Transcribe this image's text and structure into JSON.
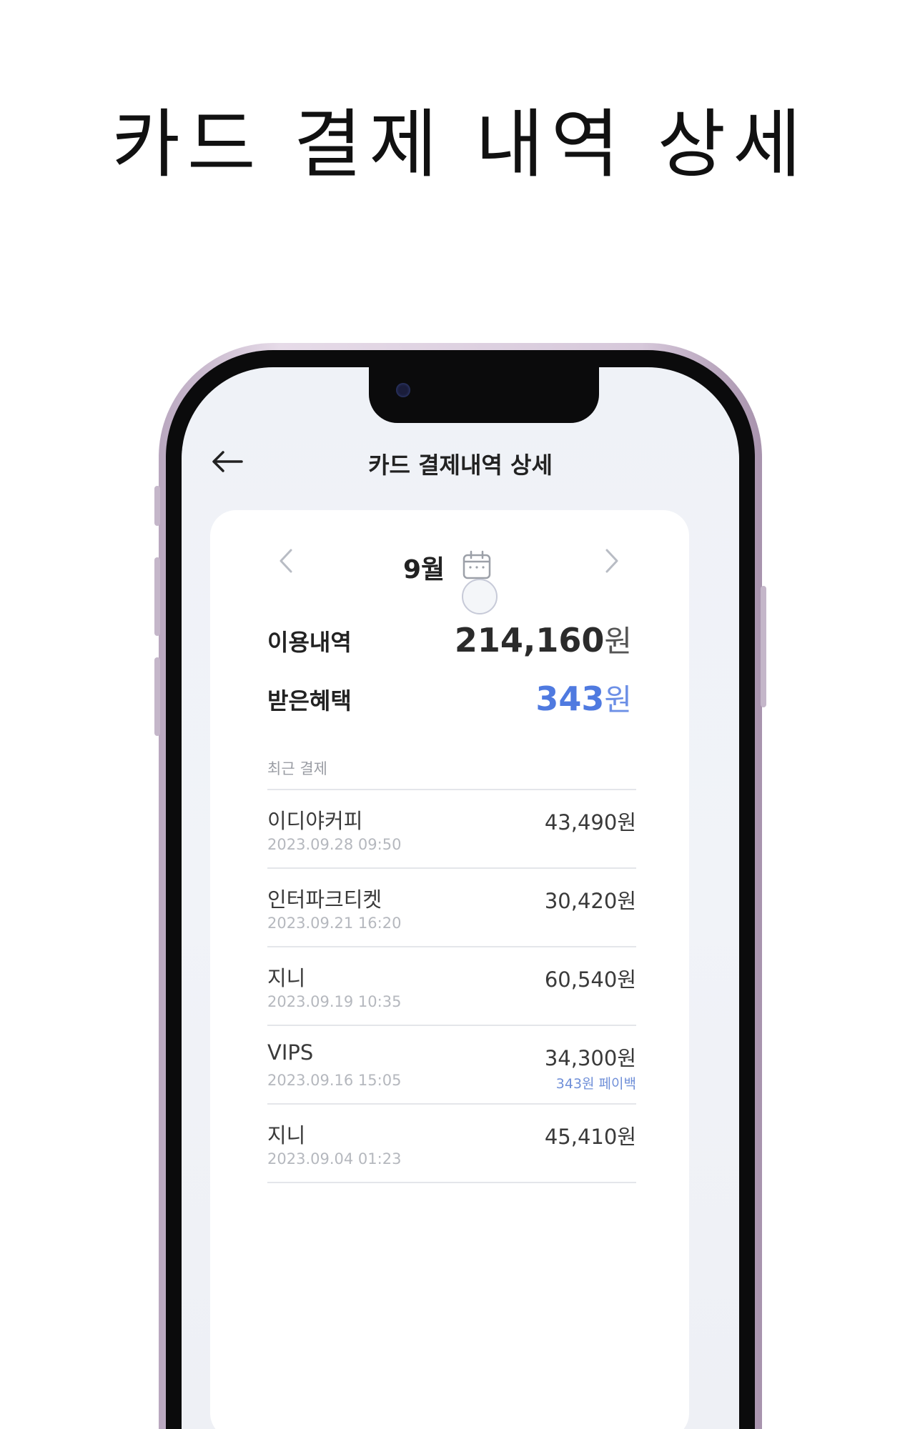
{
  "headline": "카드 결제 내역 상세",
  "header": {
    "title": "카드 결제내역 상세",
    "back_icon": "arrow-left-icon"
  },
  "month_selector": {
    "label": "9월",
    "prev_icon": "chevron-left-icon",
    "next_icon": "chevron-right-icon",
    "calendar_icon": "calendar-icon"
  },
  "summary": {
    "usage_label": "이용내역",
    "usage_amount": "214,160",
    "benefit_label": "받은혜택",
    "benefit_amount": "343",
    "currency": "원"
  },
  "recent": {
    "label": "최근 결제",
    "items": [
      {
        "name": "이디야커피",
        "date": "2023.09.28 09:50",
        "amount": "43,490원",
        "benefit": ""
      },
      {
        "name": "인터파크티켓",
        "date": "2023.09.21 16:20",
        "amount": "30,420원",
        "benefit": ""
      },
      {
        "name": "지니",
        "date": "2023.09.19 10:35",
        "amount": "60,540원",
        "benefit": ""
      },
      {
        "name": "VIPS",
        "date": "2023.09.16 15:05",
        "amount": "34,300원",
        "benefit": "343원 페이백"
      },
      {
        "name": "지니",
        "date": "2023.09.04 01:23",
        "amount": "45,410원",
        "benefit": ""
      }
    ]
  },
  "colors": {
    "accent_blue": "#4f7ae0",
    "frame": "#d6c8da"
  }
}
